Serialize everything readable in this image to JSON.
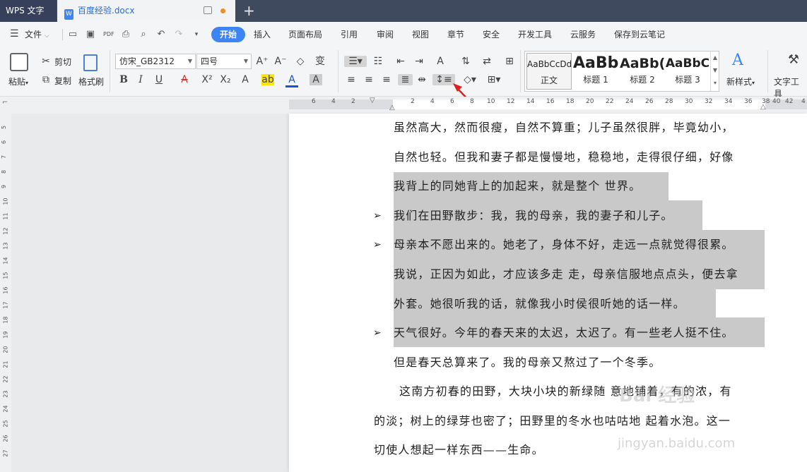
{
  "titlebar": {
    "app_name": "WPS 文字",
    "doc_name": "百度经验.docx",
    "doc_icon": "W",
    "new_tab": "+"
  },
  "menu": {
    "file": "文件",
    "items": [
      "开始",
      "插入",
      "页面布局",
      "引用",
      "审阅",
      "视图",
      "章节",
      "安全",
      "开发工具",
      "云服务",
      "保存到云笔记"
    ]
  },
  "ribbon": {
    "paste": "粘贴",
    "cut": "剪切",
    "copy": "复制",
    "format_painter": "格式刷",
    "font_name": "仿宋_GB2312",
    "font_size": "四号",
    "styles": [
      {
        "preview": "AaBbCcDd",
        "name": "正文"
      },
      {
        "preview": "AaBb",
        "name": "标题 1"
      },
      {
        "preview": "AaBb(",
        "name": "标题 2"
      },
      {
        "preview": "AaBbC",
        "name": "标题 3"
      }
    ],
    "new_style": "新样式",
    "text_tools": "文字工具",
    "new_style_icon_text": "A"
  },
  "ruler": {
    "h_numbers": [
      "6",
      "4",
      "2",
      "2",
      "4",
      "6",
      "8",
      "10",
      "12",
      "14",
      "16",
      "18",
      "20",
      "22",
      "24",
      "26",
      "28",
      "30",
      "32",
      "34",
      "36",
      "38",
      "40",
      "42",
      "4"
    ],
    "v_numbers": [
      "5",
      "6",
      "7",
      "8",
      "9",
      "10",
      "11",
      "12",
      "13",
      "14",
      "15",
      "16",
      "17",
      "18",
      "19",
      "20",
      "21",
      "22",
      "23",
      "24",
      "25",
      "26",
      "27"
    ]
  },
  "document": {
    "lines": [
      "虽然高大，然而很瘦，自然不算重；儿子虽然很胖，毕竟幼小，",
      "自然也轻。但我和妻子都是慢慢地，稳稳地，走得很仔细，好像",
      "我背上的同她背上的加起来，就是整个 世界。",
      "我们在田野散步：我，我的母亲，我的妻子和儿子。",
      "母亲本不愿出来的。她老了，身体不好，走远一点就觉得很累。",
      "我说，正因为如此，才应该多走 走，母亲信服地点点头，便去拿",
      "外套。她很听我的话，就像我小时侯很听她的话一样。",
      "天气很好。今年的春天来的太迟，太迟了。有一些老人挺不住。",
      "但是春天总算来了。我的母亲又熬过了一个冬季。",
      "这南方初春的田野，大块小块的新绿随 意地铺着，有的浓，有",
      "的淡；树上的绿芽也密了；田野里的冬水也咕咕地 起着水泡。这一",
      "切使人想起一样东西——生命。"
    ],
    "bullet": "➢"
  },
  "watermark": {
    "logo": "Bai 经验",
    "url": "jingyan.baidu.com"
  },
  "colors": {
    "accent": "#3d84f5",
    "titlebar": "#3f4a5e",
    "highlight": "#c9c9c9",
    "arrow": "#e02020"
  }
}
